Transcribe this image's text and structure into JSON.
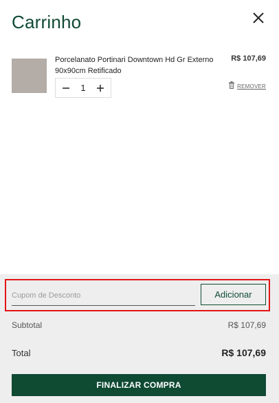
{
  "cart": {
    "title": "Carrinho",
    "close_icon": "close-icon"
  },
  "item": {
    "name": "Porcelanato Portinari Downtown Hd Gr Externo 90x90cm Retificado",
    "price": "R$ 107,69",
    "quantity": "1",
    "remove_label": "REMOVER",
    "thumbnail_color": "#b4aca6",
    "icons": {
      "decrease": "minus-icon",
      "increase": "plus-icon",
      "remove": "trash-icon"
    }
  },
  "coupon": {
    "placeholder": "Cupom de Desconto",
    "value": "",
    "button_label": "Adicionar"
  },
  "summary": {
    "subtotal_label": "Subtotal",
    "subtotal_value": "R$ 107,69",
    "total_label": "Total",
    "total_value": "R$ 107,69"
  },
  "checkout": {
    "label": "FINALIZAR COMPRA"
  },
  "colors": {
    "brand": "#0f4a33",
    "footer_bg": "#eeeeee",
    "highlight": "#e31414"
  }
}
